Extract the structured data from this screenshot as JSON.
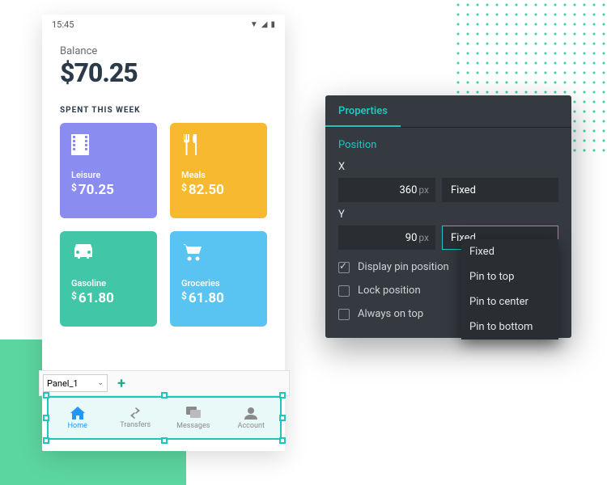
{
  "statusbar": {
    "time": "15:45"
  },
  "balance": {
    "label": "Balance",
    "amount": "$70.25"
  },
  "spent_label": "SPENT THIS WEEK",
  "cards": {
    "leisure": {
      "name": "Leisure",
      "amount": "70.25"
    },
    "meals": {
      "name": "Meals",
      "amount": "82.50"
    },
    "gasoline": {
      "name": "Gasoline",
      "amount": "61.80"
    },
    "groceries": {
      "name": "Groceries",
      "amount": "61.80"
    }
  },
  "editor": {
    "panel_name": "Panel_1"
  },
  "nav": {
    "home": "Home",
    "transfers": "Transfers",
    "messages": "Messages",
    "account": "Account"
  },
  "props": {
    "tab": "Properties",
    "section": "Position",
    "x_label": "X",
    "x_value": "360",
    "x_unit": "px",
    "x_mode": "Fixed",
    "y_label": "Y",
    "y_value": "90",
    "y_unit": "px",
    "y_mode": "Fixed",
    "display_pin": "Display pin position",
    "lock": "Lock position",
    "always_top": "Always on top",
    "dd": {
      "o1": "Fixed",
      "o2": "Pin to top",
      "o3": "Pin to center",
      "o4": "Pin to bottom"
    }
  }
}
